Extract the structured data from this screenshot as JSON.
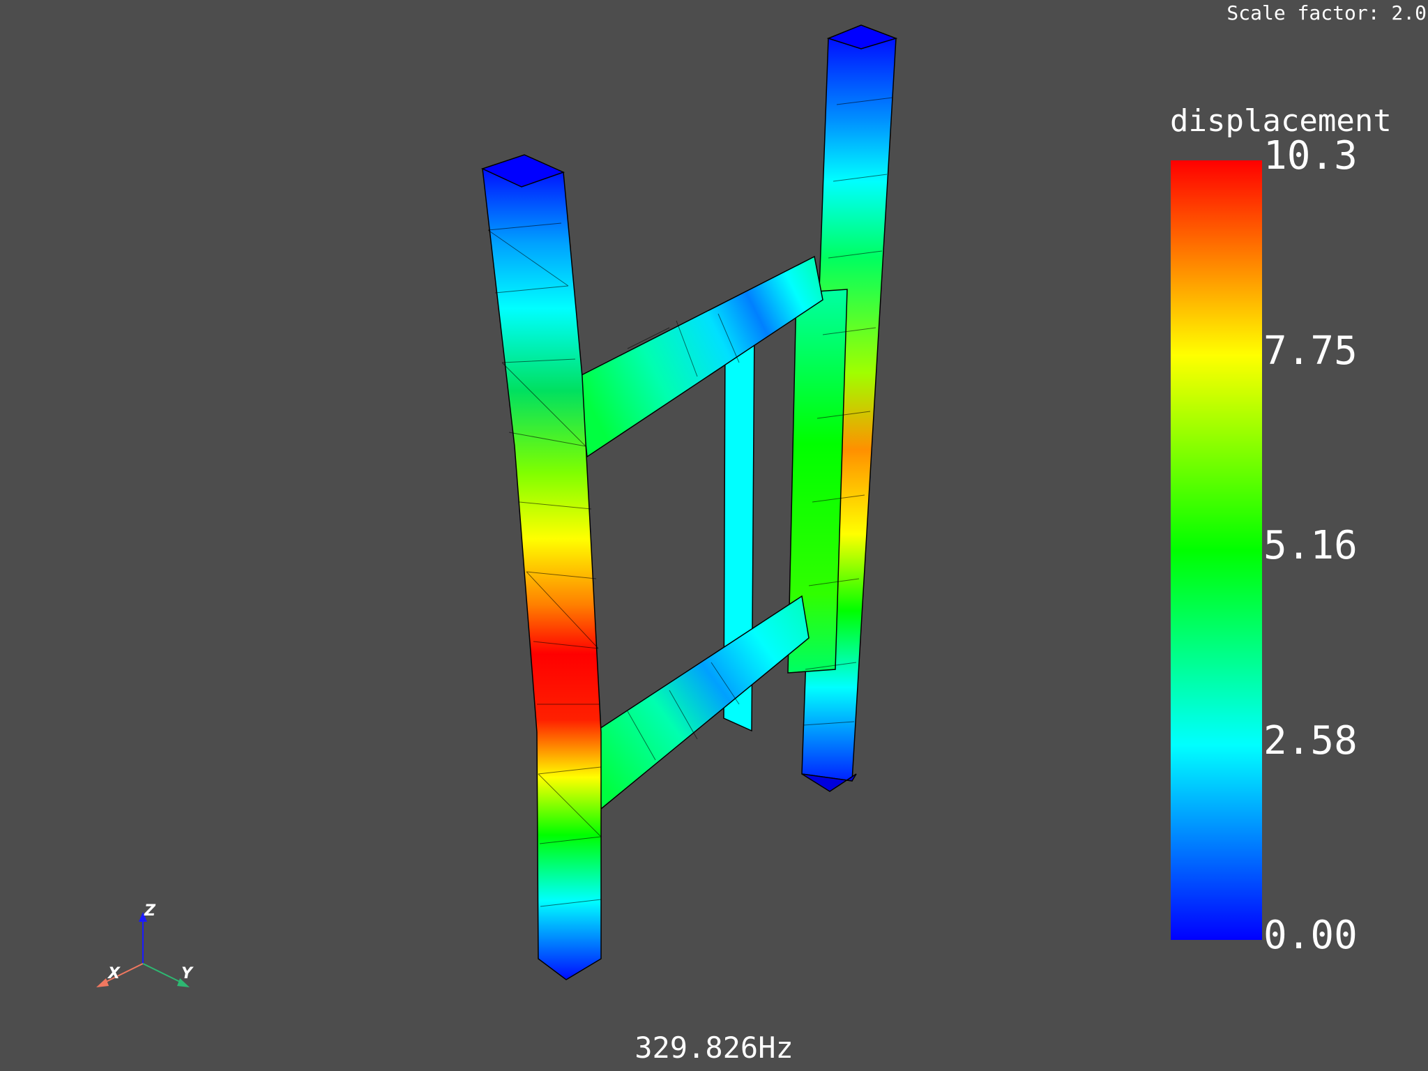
{
  "overlay": {
    "scale_factor": "Scale factor: 2.0",
    "frequency": "329.826Hz"
  },
  "colorbar": {
    "title": "displacement",
    "ticks": [
      "10.3",
      "7.75",
      "5.16",
      "2.58",
      "0.00"
    ],
    "min": 0.0,
    "max": 10.3,
    "colors": [
      "#0000ff",
      "#00ffff",
      "#00ff00",
      "#ffff00",
      "#ff0000"
    ]
  },
  "axes_triad": {
    "x": "X",
    "y": "Y",
    "z": "Z",
    "x_color": "#f07860",
    "y_color": "#2eb872",
    "z_color": "#1a1aff"
  },
  "background": "#4d4d4d"
}
